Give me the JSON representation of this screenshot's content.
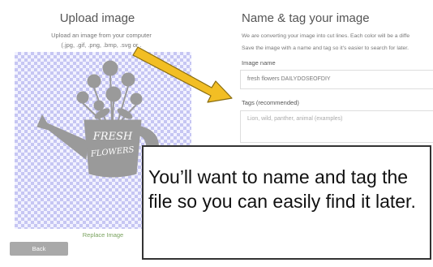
{
  "upload": {
    "title": "Upload image",
    "subtitle_line1": "Upload an image from your computer",
    "subtitle_line2": "(.jpg, .gif, .png, .bmp, .svg or .",
    "replace_link": "Replace Image",
    "back_label": "Back"
  },
  "image_art": {
    "line1": "FRESH",
    "line2": "FLOWERS"
  },
  "details": {
    "title": "Name & tag your image",
    "info_line1": "We are converting your image into cut lines. Each color will be a diffe",
    "info_line2": "Save the image with a name and tag so it's easier to search for later.",
    "name_label": "Image name",
    "name_value": "fresh flowers DAILYDOSEOFDIY",
    "tags_label": "Tags (recommended)",
    "tags_placeholder": "Lion, wild, panther, animal (examples)"
  },
  "callout": {
    "text": "You’ll want to name and tag the file so you can easily find it later."
  },
  "colors": {
    "arrow_fill": "#F2BE24",
    "arrow_stroke": "#8A6D10",
    "checker_blue": "#c6c6f3",
    "art_gray": "#9a9a9a",
    "back_button": "#a9a9a9",
    "link_green": "#7aa35f"
  }
}
